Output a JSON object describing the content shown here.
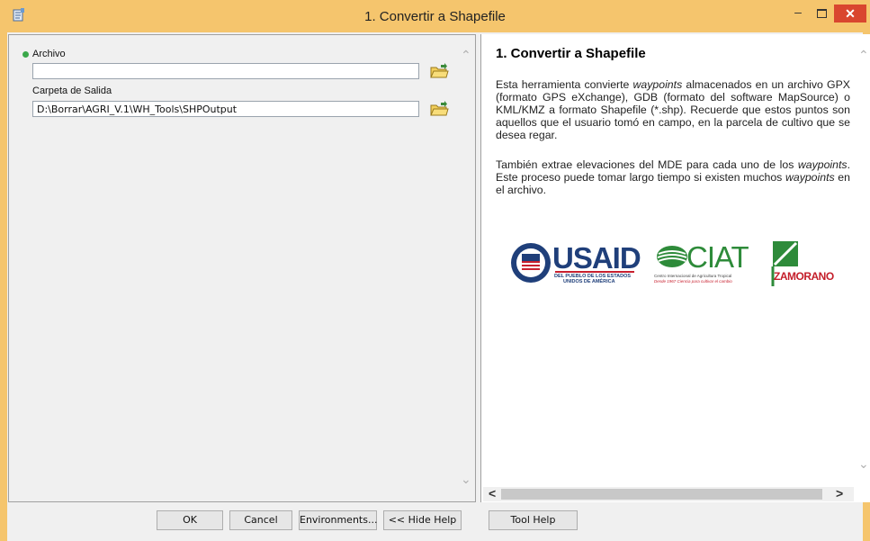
{
  "window": {
    "title": "1. Convertir a Shapefile",
    "min_label": "–",
    "close_label": "✕"
  },
  "form": {
    "archivo_label": "Archivo",
    "archivo_value": "",
    "carpeta_label": "Carpeta de Salida",
    "carpeta_value": "D:\\Borrar\\AGRI_V.1\\WH_Tools\\SHPOutput"
  },
  "help": {
    "title": "1. Convertir a Shapefile",
    "p1": [
      {
        "t": "Esta herramienta convierte "
      },
      {
        "t": "waypoints",
        "i": true
      },
      {
        "t": " almacenados en un archivo GPX (formato GPS eXchange), GDB (formato del software MapSource) o KML/KMZ a formato Shapefile (*.shp). Recuerde que estos puntos son aquellos que el usuario tomó en campo, en la parcela de cultivo que se desea regar."
      }
    ],
    "p2": [
      {
        "t": "También extrae elevaciones del MDE para cada uno de los "
      },
      {
        "t": "waypoints",
        "i": true
      },
      {
        "t": ". Este proceso puede tomar largo tiempo si existen muchos "
      },
      {
        "t": "waypoints",
        "i": true
      },
      {
        "t": " en el archivo."
      }
    ],
    "logos": {
      "usaid_word": "USAID",
      "usaid_sub1": "DEL PUEBLO DE LOS ESTADOS",
      "usaid_sub2": "UNIDOS DE AMÉRICA",
      "ciat_word": "CIAT",
      "ciat_sub1": "Centro Internacional de Agricultura Tropical",
      "ciat_sub2": "Desde 1967 Ciencia para cultivar el cambio",
      "zamorano_word": "ZAMORANO"
    }
  },
  "buttons": {
    "ok": "OK",
    "cancel": "Cancel",
    "environments": "Environments...",
    "hide_help": "<< Hide Help",
    "tool_help": "Tool Help"
  },
  "scroll": {
    "left_arrow": "<",
    "right_arrow": ">"
  },
  "colors": {
    "title_bar": "#f5c56d",
    "close": "#d9462f",
    "usaid_blue": "#1f3f7a",
    "usaid_red": "#c8202f",
    "ciat_green": "#2e8b3a",
    "zamorano_red": "#c41e2a"
  }
}
